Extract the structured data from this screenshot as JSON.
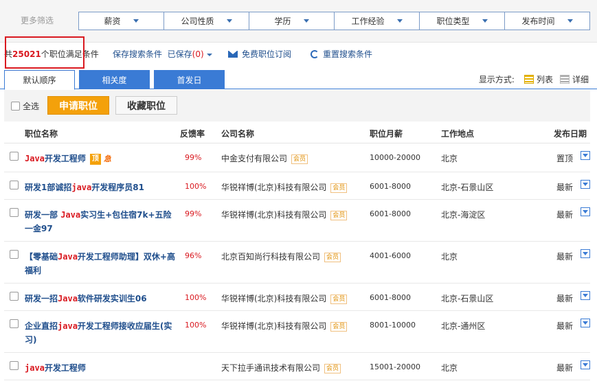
{
  "filters": {
    "label": "更多筛选",
    "items": [
      "薪资",
      "公司性质",
      "学历",
      "工作经验",
      "职位类型",
      "发布时间"
    ]
  },
  "summary": {
    "prefix": "共",
    "count": "25021",
    "suffix": "个职位满足条件",
    "save_search": "保存搜索条件",
    "saved_prefix": "已保存",
    "saved_count": "(0)",
    "subscribe": "免费职位订阅",
    "reset": "重置搜索条件"
  },
  "tabs": [
    "默认顺序",
    "相关度",
    "首发日"
  ],
  "view_mode": {
    "label": "显示方式:",
    "list": "列表",
    "detail": "详细"
  },
  "actions": {
    "select_all": "全选",
    "apply": "申请职位",
    "favorite": "收藏职位"
  },
  "columns": [
    "职位名称",
    "反馈率",
    "公司名称",
    "职位月薪",
    "工作地点",
    "发布日期"
  ],
  "vip_label": "会员",
  "badges": {
    "ding": "顶",
    "ji": "急"
  },
  "colors": {
    "accent_blue": "#3a7bd5",
    "highlight_red": "#d9181f",
    "orange": "#f4a10b"
  },
  "jobs": [
    {
      "title_parts": [
        [
          "Java",
          true
        ],
        [
          "开发工程师",
          false
        ]
      ],
      "badges": true,
      "feedback": "99%",
      "company": "中金支付有限公司",
      "salary": "10000-20000",
      "location": "北京",
      "date": "置顶",
      "height": 42
    },
    {
      "title_parts": [
        [
          "研发1部诚招",
          false
        ],
        [
          "java",
          true
        ],
        [
          "开发程序员81",
          false
        ]
      ],
      "badges": false,
      "feedback": "100%",
      "company": "华锐祥博(北京)科技有限公司",
      "salary": "6001-8000",
      "location": "北京-石景山区",
      "date": "最新",
      "height": 40
    },
    {
      "title_parts": [
        [
          "研发一部 ",
          false
        ],
        [
          "Java",
          true
        ],
        [
          "实习生+包住宿7k+五险一金97",
          false
        ]
      ],
      "badges": false,
      "feedback": "99%",
      "company": "华锐祥博(北京)科技有限公司",
      "salary": "6001-8000",
      "location": "北京-海淀区",
      "date": "最新",
      "height": 61
    },
    {
      "title_parts": [
        [
          "【零基础",
          false
        ],
        [
          "Java",
          true
        ],
        [
          "开发工程师助理】双休+高福利",
          false
        ]
      ],
      "badges": false,
      "feedback": "96%",
      "company": "北京百知尚行科技有限公司",
      "salary": "4001-6000",
      "location": "北京",
      "date": "最新",
      "height": 61
    },
    {
      "title_parts": [
        [
          "研发一招",
          false
        ],
        [
          "Java",
          true
        ],
        [
          "软件研发实训生06",
          false
        ]
      ],
      "badges": false,
      "feedback": "100%",
      "company": "华锐祥博(北京)科技有限公司",
      "salary": "6001-8000",
      "location": "北京-石景山区",
      "date": "最新",
      "height": 40
    },
    {
      "title_parts": [
        [
          "企业直招",
          false
        ],
        [
          "java",
          true
        ],
        [
          "开发工程师接收应届生(实习)",
          false
        ]
      ],
      "badges": false,
      "feedback": "100%",
      "company": "华锐祥博(北京)科技有限公司",
      "salary": "8001-10000",
      "location": "北京-通州区",
      "date": "最新",
      "height": 61
    },
    {
      "title_parts": [
        [
          "java",
          true
        ],
        [
          "开发工程师",
          false
        ]
      ],
      "badges": false,
      "feedback": "",
      "company": "天下拉手通讯技术有限公司",
      "salary": "15001-20000",
      "location": "北京",
      "date": "最新",
      "height": 40
    }
  ]
}
